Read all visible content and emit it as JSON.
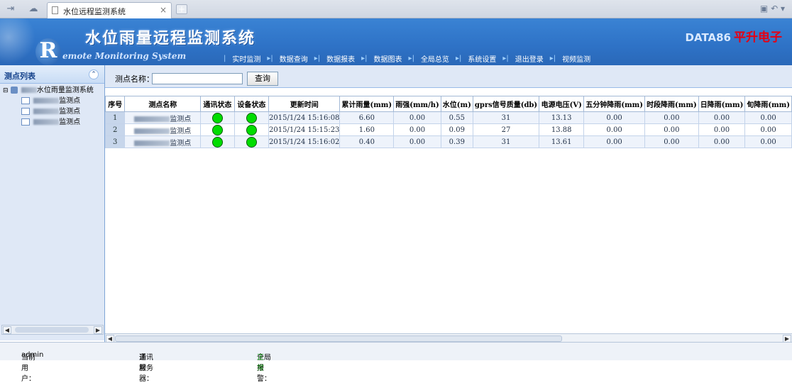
{
  "browser": {
    "tab_title": "水位远程监测系统",
    "tab_close": "×",
    "new_tab": "+"
  },
  "header": {
    "title": "水位雨量远程监测系统",
    "logo_letter": "R",
    "subtitle": "emote Monitoring System",
    "brand_en": "DATA86",
    "brand_cn": "平升电子"
  },
  "nav": {
    "items": [
      "实时监测",
      "数据查询",
      "数据报表",
      "数据图表",
      "全局总览",
      "系统设置",
      "退出登录",
      "视频监测"
    ]
  },
  "sidebar": {
    "title": "测点列表",
    "root_label": "水位雨量监测系统",
    "leaves": [
      "监测点",
      "监测点",
      "监测点"
    ]
  },
  "search": {
    "label": "测点名称：",
    "value": "",
    "button": "查询"
  },
  "table": {
    "headers": [
      "序号",
      "测点名称",
      "通讯状态",
      "设备状态",
      "更新时间",
      "累计雨量(mm)",
      "雨强(mm/h)",
      "水位(m)",
      "gprs信号质量(db)",
      "电源电压(V)",
      "五分钟降雨(mm)",
      "时段降雨(mm)",
      "日降雨(mm)",
      "旬降雨(mm)"
    ],
    "rows": [
      {
        "idx": "1",
        "name": "监测点",
        "time": "2015/1/24 15:16:08",
        "rain_total": "6.60",
        "rain_rate": "0.00",
        "level": "0.55",
        "gprs": "31",
        "voltage": "13.13",
        "rain_5min": "0.00",
        "rain_period": "0.00",
        "rain_day": "0.00",
        "rain_10day": "0.00"
      },
      {
        "idx": "2",
        "name": "监测点",
        "time": "2015/1/24 15:15:23",
        "rain_total": "1.60",
        "rain_rate": "0.00",
        "level": "0.09",
        "gprs": "27",
        "voltage": "13.88",
        "rain_5min": "0.00",
        "rain_period": "0.00",
        "rain_day": "0.00",
        "rain_10day": "0.00"
      },
      {
        "idx": "3",
        "name": "监测点",
        "time": "2015/1/24 15:16:02",
        "rain_total": "0.40",
        "rain_rate": "0.00",
        "level": "0.39",
        "gprs": "31",
        "voltage": "13.61",
        "rain_5min": "0.00",
        "rain_period": "0.00",
        "rain_day": "0.00",
        "rain_10day": "0.00"
      }
    ]
  },
  "status": {
    "user_label": "当前用户：",
    "user": "admin",
    "server_label": "通讯服务器：",
    "server_value": "正常",
    "alarm_label": "全局报警：",
    "alarm_value": "正常"
  },
  "colors": {
    "header_blue": "#2e72c6",
    "online_green": "#00dd00",
    "brand_red": "#e60012"
  }
}
